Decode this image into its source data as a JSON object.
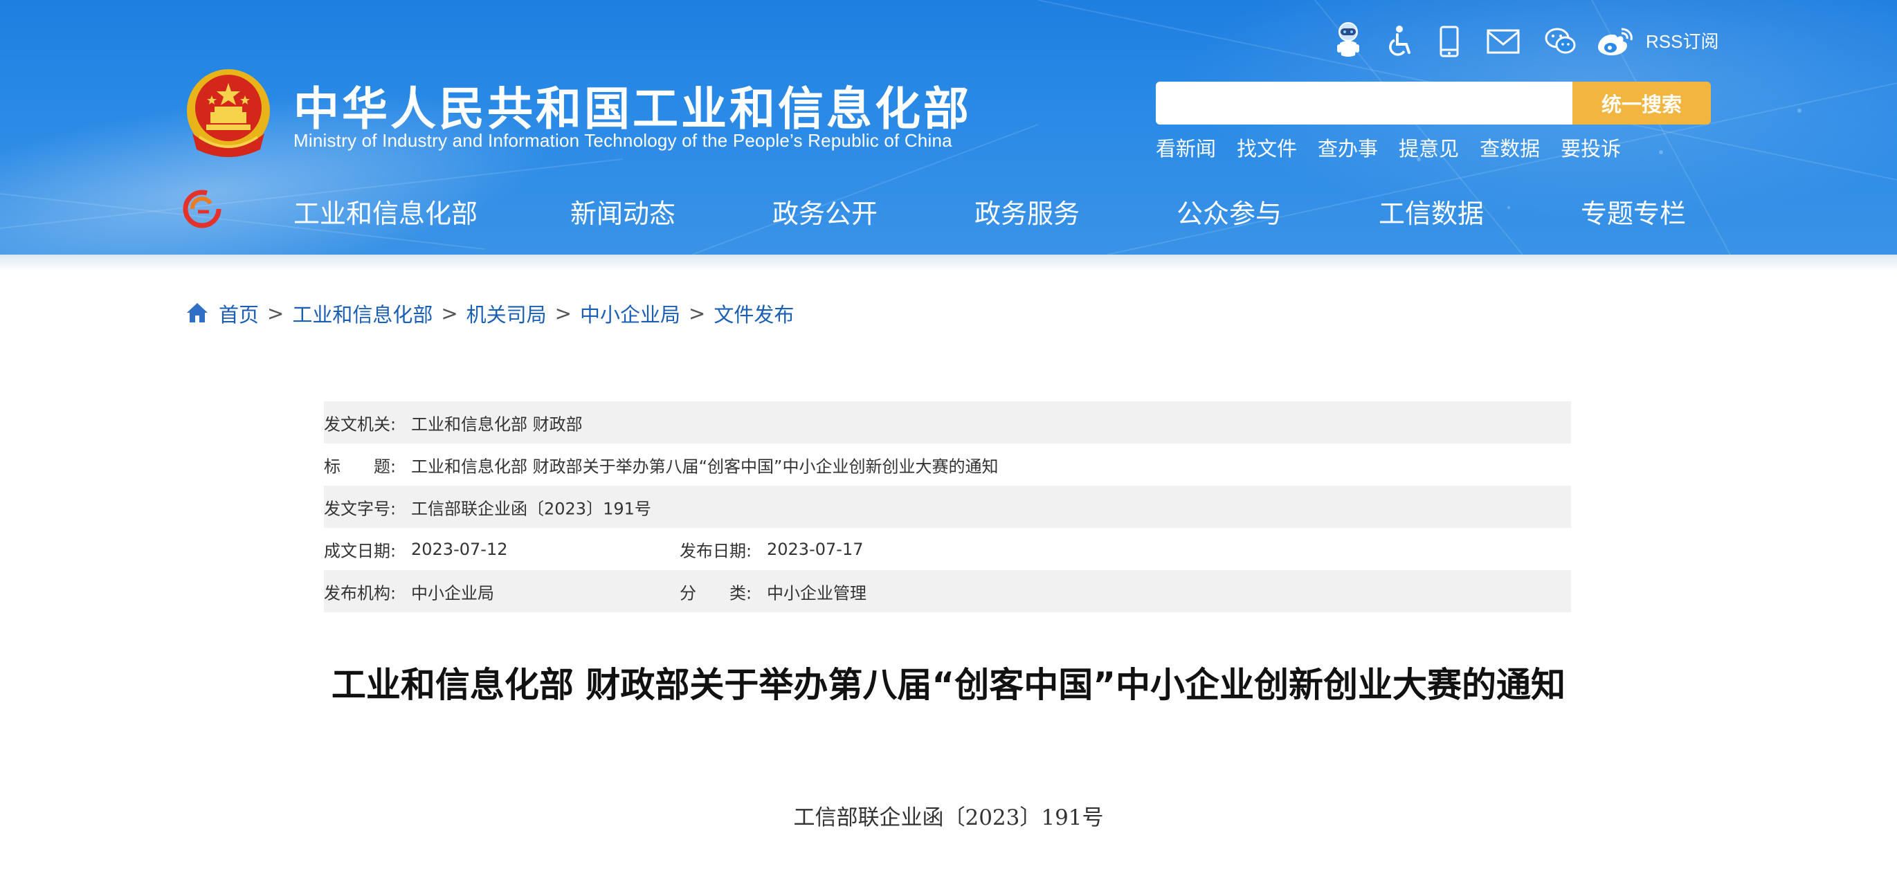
{
  "header": {
    "title": "中华人民共和国工业和信息化部",
    "subtitle": "Ministry of Industry and Information Technology of the People’s Republic of China",
    "rss_label": "RSS订阅",
    "top_icons": [
      "robot-assistant-icon",
      "accessibility-icon",
      "mobile-icon",
      "mail-icon",
      "wechat-icon",
      "weibo-icon"
    ],
    "search": {
      "placeholder": "",
      "button_label": "统一搜索"
    },
    "quick_links": [
      "看新闻",
      "找文件",
      "查办事",
      "提意见",
      "查数据",
      "要投诉"
    ],
    "nav": [
      "工业和信息化部",
      "新闻动态",
      "政务公开",
      "政务服务",
      "公众参与",
      "工信数据",
      "专题专栏"
    ]
  },
  "breadcrumb": {
    "home": "首页",
    "items": [
      "工业和信息化部",
      "机关司局",
      "中小企业局",
      "文件发布"
    ],
    "separator": ">"
  },
  "meta": {
    "issuer_label": "发文机关:",
    "issuer": "工业和信息化部 财政部",
    "title_label": "标　　题:",
    "title": "工业和信息化部 财政部关于举办第八届“创客中国”中小企业创新创业大赛的通知",
    "doc_no_label": "发文字号:",
    "doc_no": "工信部联企业函〔2023〕191号",
    "created_label": "成文日期:",
    "created": "2023-07-12",
    "published_label": "发布日期:",
    "published": "2023-07-17",
    "agency_label": "发布机构:",
    "agency": "中小企业局",
    "category_label": "分　　类:",
    "category": "中小企业管理"
  },
  "document": {
    "title": "工业和信息化部 财政部关于举办第八届“创客中国”中小企业创新创业大赛的通知",
    "number": "工信部联企业函〔2023〕191号"
  },
  "colors": {
    "header_blue": "#2a8ae6",
    "search_button": "#f2b540",
    "link_blue": "#1a5fb4",
    "table_shade": "#f1f1f1"
  }
}
